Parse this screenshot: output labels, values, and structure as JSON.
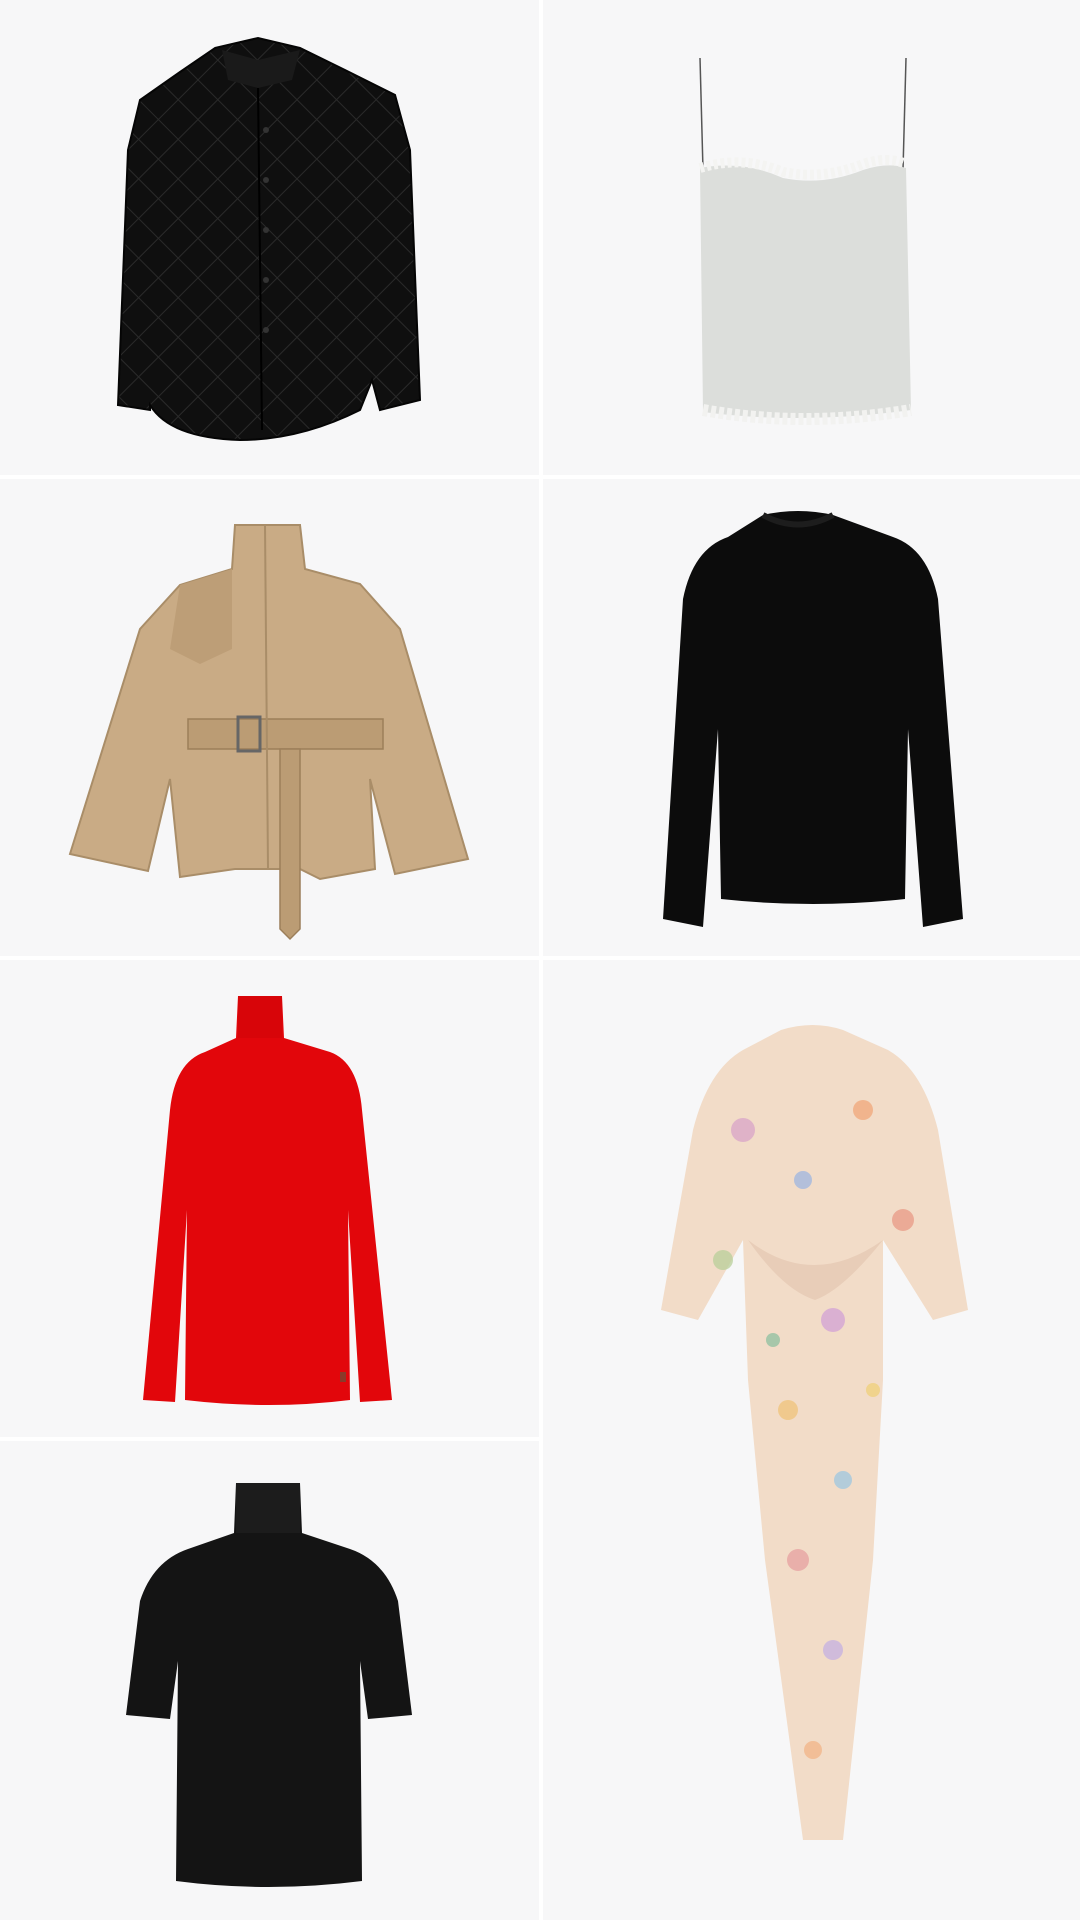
{
  "products": [
    {
      "item": "quilted-jacket",
      "color": "#0d0d0d"
    },
    {
      "item": "lace-trim-camisole",
      "color": "#dcdedb"
    },
    {
      "item": "belted-jacket",
      "color": "#c9ab85"
    },
    {
      "item": "crewneck-sweater",
      "color": "#0c0c0c"
    },
    {
      "item": "turtleneck-top",
      "color": "#e2060b"
    },
    {
      "item": "floral-twist-dress",
      "color": "#f2dcc8"
    },
    {
      "item": "short-sleeve-turtleneck",
      "color": "#141414"
    }
  ],
  "colors": {
    "cell_background": "#f7f7f8",
    "divider": "#ffffff"
  }
}
